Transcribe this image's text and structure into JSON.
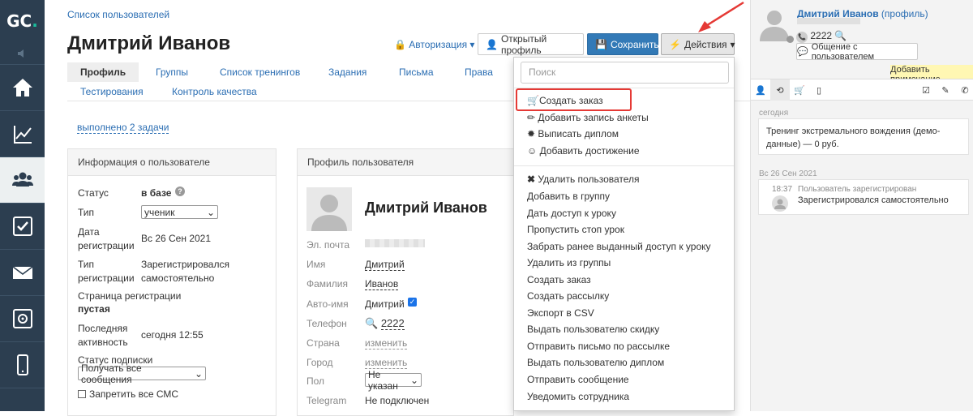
{
  "sidebar": {
    "logo_text": "GC",
    "logo_accent": ".",
    "items": [
      {
        "name": "home-icon",
        "active": false
      },
      {
        "name": "chart-icon",
        "active": false
      },
      {
        "name": "users-icon",
        "active": true
      },
      {
        "name": "tasks-icon",
        "active": false
      },
      {
        "name": "mail-icon",
        "active": false
      },
      {
        "name": "safe-icon",
        "active": false
      },
      {
        "name": "phone-icon",
        "active": false
      }
    ]
  },
  "header": {
    "breadcrumb": "Список пользователей",
    "title": "Дмитрий Иванов",
    "auth_label": "Авторизация",
    "open_profile": "Открытый профиль",
    "save": "Сохранить",
    "actions": "Действия"
  },
  "tabs": [
    "Профиль",
    "Группы",
    "Список тренингов",
    "Задания",
    "Письма",
    "Права",
    "Тестирования",
    "Контроль качества"
  ],
  "done_link": "выполнено 2 задачи",
  "user_info": {
    "heading": "Информация о пользователе",
    "status_label": "Статус",
    "status_value": "в базе",
    "type_label": "Тип",
    "type_value": "ученик",
    "regdate_label_1": "Дата",
    "regdate_label_2": "регистрации",
    "regdate_value": "Вс 26 Сен 2021",
    "regtype_label_1": "Тип",
    "regtype_label_2": "регистрации",
    "regtype_value_1": "Зарегистрировался",
    "regtype_value_2": "самостоятельно",
    "regpage_label": "Страница регистрации",
    "regpage_value": "пустая",
    "activity_label_1": "Последняя",
    "activity_label_2": "активность",
    "activity_value": "сегодня 12:55",
    "sub_label": "Статус подписки",
    "sub_value": "Получать все сообщения",
    "sms_label": "Запретить все СМС"
  },
  "profile": {
    "heading": "Профиль пользователя",
    "name": "Дмитрий Иванов",
    "email_label": "Эл. почта",
    "first_label": "Имя",
    "first_value": "Дмитрий",
    "last_label": "Фамилия",
    "last_value": "Иванов",
    "auto_label": "Авто-имя",
    "auto_value": "Дмитрий",
    "phone_label": "Телефон",
    "phone_value": "2222",
    "country_label": "Страна",
    "country_value": "изменить",
    "city_label": "Город",
    "city_value": "изменить",
    "sex_label": "Пол",
    "sex_value": "Не указан",
    "tg_label": "Telegram",
    "tg_value": "Не подключен"
  },
  "dropdown": {
    "search_placeholder": "Поиск",
    "group1": [
      "Создать заказ",
      "Добавить запись анкеты",
      "Выписать диплом",
      "Добавить достижение"
    ],
    "group2": [
      "Удалить пользователя",
      "Добавить в группу",
      "Дать доступ к уроку",
      "Пропустить стоп урок",
      "Забрать ранее выданный доступ к уроку",
      "Удалить из группы",
      "Создать заказ",
      "Создать рассылку",
      "Экспорт в CSV",
      "Выдать пользователю скидку",
      "Отправить письмо по рассылке",
      "Выдать пользователю диплом",
      "Отправить сообщение",
      "Уведомить сотрудника"
    ]
  },
  "right": {
    "name": "Дмитрий Иванов",
    "profile_link": "(профиль)",
    "phone": "2222",
    "comm_button": "Общение с пользователем",
    "add_note": "Добавить примечание",
    "date1": "сегодня",
    "event1": "Тренинг экстремального вождения (демо-данные) — 0 руб.",
    "date2": "Вс 26 Сен 2021",
    "event2_time": "18:37",
    "event2_title": "Пользователь зарегистрирован",
    "event2_text": "Зарегистрировался самостоятельно"
  },
  "colors": {
    "sidebar": "#2c3e50",
    "accent": "#1abc9c",
    "link": "#2b6eb3",
    "save": "#337ab7",
    "highlight": "#e53935"
  }
}
